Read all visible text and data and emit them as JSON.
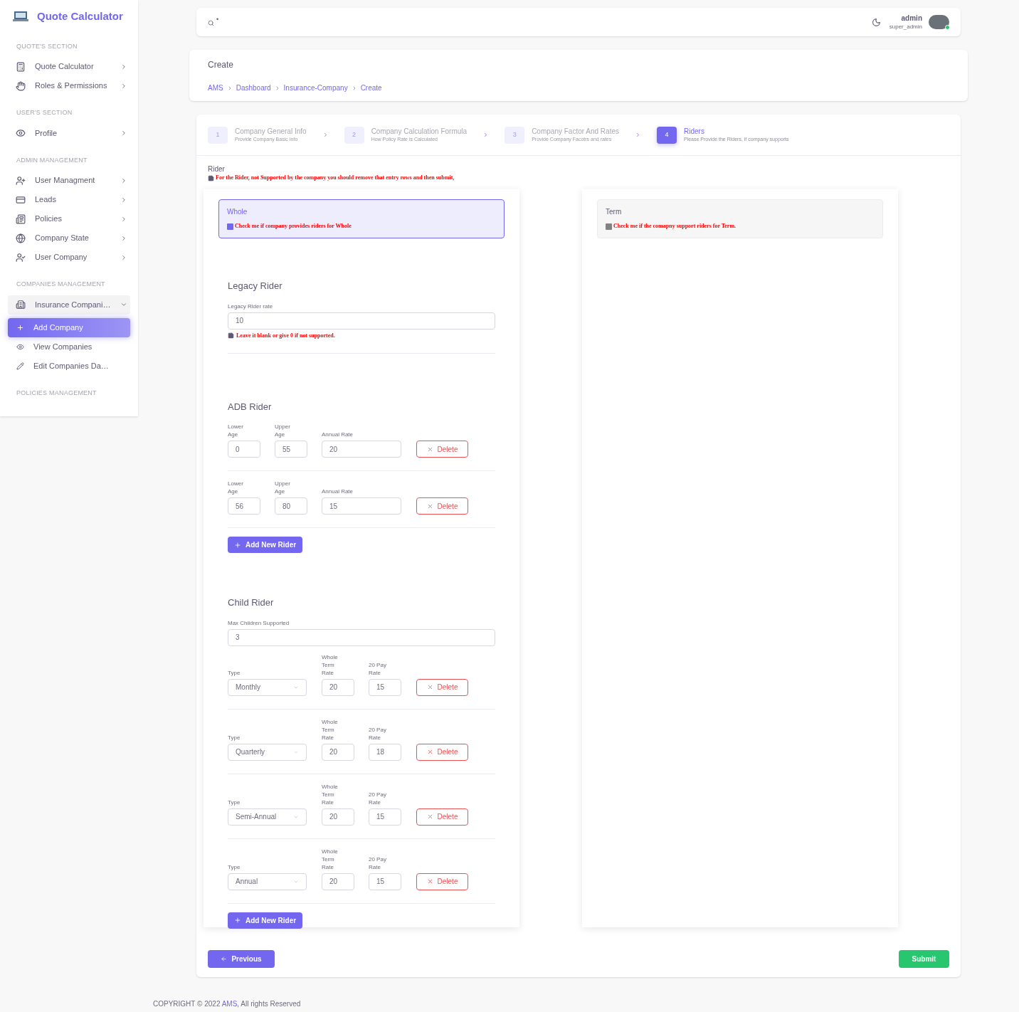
{
  "sidebar": {
    "brand": "Quote Calculator",
    "sections": [
      {
        "title": "QUOTE'S SECTION",
        "items": [
          {
            "label": "Quote Calculator",
            "selected": false
          },
          {
            "label": "Roles & Permissions",
            "selected": false
          }
        ]
      },
      {
        "title": "USER'S SECTION",
        "items": [
          {
            "label": "Profile",
            "selected": false
          }
        ]
      },
      {
        "title": "ADMIN MANAGEMENT",
        "items": [
          {
            "label": "User Managment",
            "selected": false
          },
          {
            "label": "Leads",
            "selected": false
          },
          {
            "label": "Policies",
            "selected": false
          },
          {
            "label": "Company State",
            "selected": false
          },
          {
            "label": "User Company",
            "selected": false
          }
        ]
      },
      {
        "title": "COMPANIES MANAGEMENT",
        "items": [
          {
            "label": "Insurance Compani…",
            "selected": false,
            "expanded": true,
            "children": [
              {
                "label": "Add Company",
                "selected": true
              },
              {
                "label": "View Companies",
                "selected": false
              },
              {
                "label": "Edit Companies Da…",
                "selected": false
              }
            ]
          }
        ]
      },
      {
        "title": "POLICIES MANAGEMENT"
      }
    ]
  },
  "header": {
    "search_mark": "•",
    "user_name": "admin",
    "user_role": "super_admin",
    "online": true
  },
  "page_header": {
    "title": "Create",
    "breadcrumbs": [
      "AMS",
      "Dashboard",
      "Insurance-Company",
      "Create"
    ]
  },
  "steps": [
    {
      "number": "1",
      "title": "Company General Info",
      "subtitle": "Provide Company Basic Info",
      "selected": false
    },
    {
      "number": "2",
      "title": "Company Calculation Formula",
      "subtitle": "How Policy Rate is Calculated",
      "selected": false
    },
    {
      "number": "3",
      "title": "Company Factor And Rates",
      "subtitle": "Provide Company Facotrs and rates",
      "selected": false
    },
    {
      "number": "4",
      "title": "Riders",
      "subtitle": "Please Provide the Riders, if company supports",
      "selected": true
    }
  ],
  "rider": {
    "label": "Rider",
    "note": "For the Rider, not Supported by the company you should remove that entry rows and then submit,"
  },
  "columns": [
    {
      "title": "Whole",
      "checkbox_label": "Check me if company provides riders for Whole",
      "checked": true,
      "legacy": {
        "title": "Legacy Rider",
        "field_label": "Legacy Rider rate",
        "value": "10",
        "note": "Leave it blank or give 0 if not supported."
      },
      "adb": {
        "title": "ADB Rider",
        "add_label": "Add New Rider",
        "rows": [
          {
            "lower_label": "Lower Age",
            "lower": "0",
            "upper_label": "Upper Age",
            "upper": "55",
            "rate_label": "Annual Rate",
            "rate": "20",
            "delete": "Delete"
          },
          {
            "lower_label": "Lower Age",
            "lower": "56",
            "upper_label": "Upper Age",
            "upper": "80",
            "rate_label": "Annual Rate",
            "rate": "15",
            "delete": "Delete"
          }
        ]
      },
      "child": {
        "title": "Child Rider",
        "field_label": "Max Children Supported",
        "value": "3",
        "add_label": "Add New Rider",
        "rows": [
          {
            "type_label": "Type",
            "type": "Monthly",
            "whole_term_label": "Whole Term Rate",
            "whole_term": "20",
            "pay20_label": "20 Pay Rate",
            "pay20": "15",
            "delete": "Delete"
          },
          {
            "type_label": "Type",
            "type": "Quarterly",
            "whole_term_label": "Whole Term Rate",
            "whole_term": "20",
            "pay20_label": "20 Pay Rate",
            "pay20": "18",
            "delete": "Delete"
          },
          {
            "type_label": "Type",
            "type": "Semi-Annual",
            "whole_term_label": "Whole Term Rate",
            "whole_term": "20",
            "pay20_label": "20 Pay Rate",
            "pay20": "15",
            "delete": "Delete"
          },
          {
            "type_label": "Type",
            "type": "Annual",
            "whole_term_label": "Whole Term Rate",
            "whole_term": "20",
            "pay20_label": "20 Pay Rate",
            "pay20": "15",
            "delete": "Delete"
          }
        ]
      }
    },
    {
      "title": "Term",
      "checkbox_label": "Check me if the comapny support riders for Term.",
      "checked": false
    }
  ],
  "actions": {
    "previous": "Previous",
    "submit": "Submit"
  },
  "footer": {
    "prefix": "COPYRIGHT © 2022",
    "link": "AMS",
    "suffix": ", All rights Reserved"
  }
}
